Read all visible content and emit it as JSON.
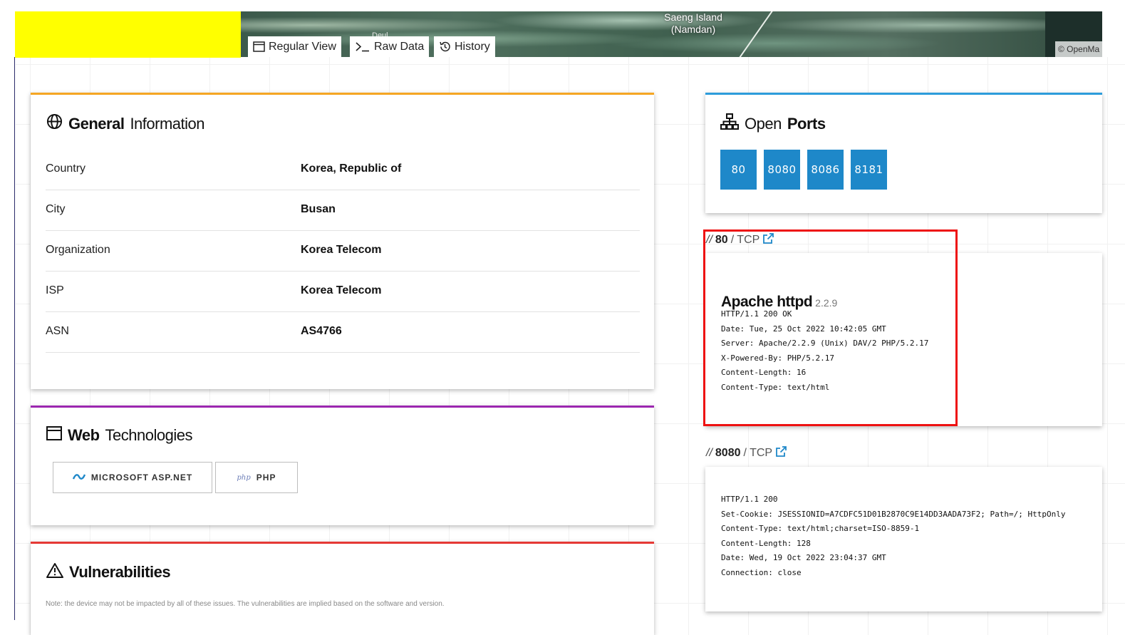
{
  "map": {
    "island_label": "Saeng Island (Namdan)",
    "island_line1": "Saeng Island",
    "island_line2": "(Namdan)",
    "partial_label": "Deul",
    "attribution": "© OpenMa"
  },
  "view_tabs": [
    {
      "label": "Regular View",
      "icon": "window-icon"
    },
    {
      "label": "Raw Data",
      "icon": "terminal-icon"
    },
    {
      "label": "History",
      "icon": "history-icon"
    }
  ],
  "general_info": {
    "title_bold": "General",
    "title_rest": "Information",
    "accent": "#f5a623",
    "rows": [
      {
        "key": "Country",
        "value": "Korea, Republic of"
      },
      {
        "key": "City",
        "value": "Busan"
      },
      {
        "key": "Organization",
        "value": "Korea Telecom"
      },
      {
        "key": "ISP",
        "value": "Korea Telecom"
      },
      {
        "key": "ASN",
        "value": "AS4766"
      }
    ]
  },
  "web_tech": {
    "title_bold": "Web",
    "title_rest": "Technologies",
    "accent": "#9c27b0",
    "items": [
      {
        "label": "MICROSOFT ASP.NET",
        "icon": "aspnet-icon"
      },
      {
        "label": "PHP",
        "icon": "php-icon"
      }
    ]
  },
  "vulnerabilities": {
    "title": "Vulnerabilities",
    "accent": "#e53935",
    "note": "Note: the device may not be impacted by all of these issues. The vulnerabilities are implied based on the software and version."
  },
  "open_ports": {
    "title_rest": "Open",
    "title_bold": "Ports",
    "accent": "#2d9cdb",
    "button_color": "#1e88c9",
    "ports": [
      "80",
      "8080",
      "8086",
      "8181"
    ]
  },
  "services": [
    {
      "prefix": "//",
      "port": "80",
      "proto": "/ TCP",
      "product": "Apache httpd",
      "version": "2.2.9",
      "banner": [
        "HTTP/1.1 200 OK",
        "Date: Tue, 25 Oct 2022 10:42:05 GMT",
        "Server: Apache/2.2.9 (Unix) DAV/2 PHP/5.2.17",
        "X-Powered-By: PHP/5.2.17",
        "Content-Length: 16",
        "Content-Type: text/html"
      ]
    },
    {
      "prefix": "//",
      "port": "8080",
      "proto": "/ TCP",
      "banner": [
        "HTTP/1.1 200",
        "Set-Cookie: JSESSIONID=A7CDFC51D01B2870C9E14DD3AADA73F2; Path=/; HttpOnly",
        "Content-Type: text/html;charset=ISO-8859-1",
        "Content-Length: 128",
        "Date: Wed, 19 Oct 2022 23:04:37 GMT",
        "Connection: close"
      ]
    }
  ],
  "highlight_color": "#ee1111"
}
